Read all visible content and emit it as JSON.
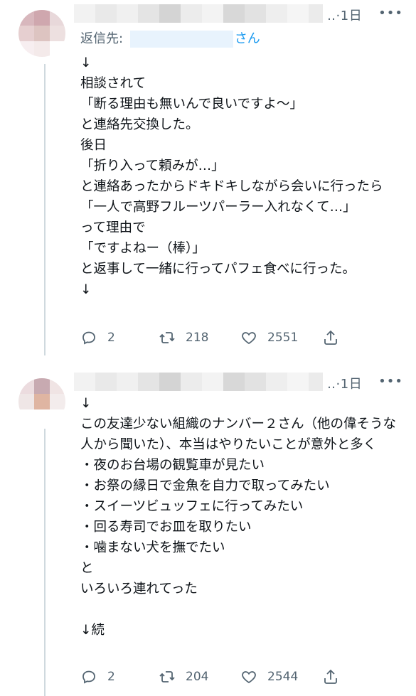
{
  "tweets": [
    {
      "time": "1日",
      "more": "•••",
      "reply_to_prefix": "返信先:",
      "reply_to_suffix": "さん",
      "text": "↓\n相談されて\n「断る理由も無いんで良いですよ〜」\nと連絡先交換した。\n後日\n「折り入って頼みが…」\nと連絡あったからドキドキしながら会いに行ったら\n「一人で高野フルーツパーラー入れなくて…」\nって理由で\n「ですよねー（棒）」\nと返事して一緒に行ってパフェ食べに行った。\n↓",
      "replies": "2",
      "retweets": "218",
      "likes": "2551",
      "avatar_colors": [
        "#d8b7bd",
        "#cfa7ae",
        "#ffffff",
        "#e6cfd0",
        "#ddc4c1",
        "#ffffff",
        "#f7eef0",
        "#f4eaea",
        "#ffffff"
      ]
    },
    {
      "time": "1日",
      "more": "•••",
      "text": "↓\nこの友達少ない組織のナンバー２さん（他の偉そうな人から聞いた）、本当はやりたいことが意外と多く\n・夜のお台場の観覧車が見たい\n・お祭の縁日で金魚を自力で取ってみたい\n・スイーツビュッフェに行ってみたい\n・回る寿司でお皿を取りたい\n・噛まない犬を撫でたい\nと\nいろいろ連れてった\n\n↓続",
      "replies": "2",
      "retweets": "204",
      "likes": "2544",
      "avatar_colors": [
        "#ecdcdf",
        "#c8aab1",
        "#f0e4e4",
        "#efe6e6",
        "#dfb5a2",
        "#f3ecec",
        "#ffffff",
        "#ffffff",
        "#ffffff"
      ]
    }
  ],
  "icons": {
    "reply": "reply-icon",
    "retweet": "retweet-icon",
    "like": "heart-icon",
    "share": "share-icon"
  },
  "colors": {
    "accent": "#1d9bf0",
    "secondary_text": "#536471",
    "thread_line": "#cfd9de"
  }
}
